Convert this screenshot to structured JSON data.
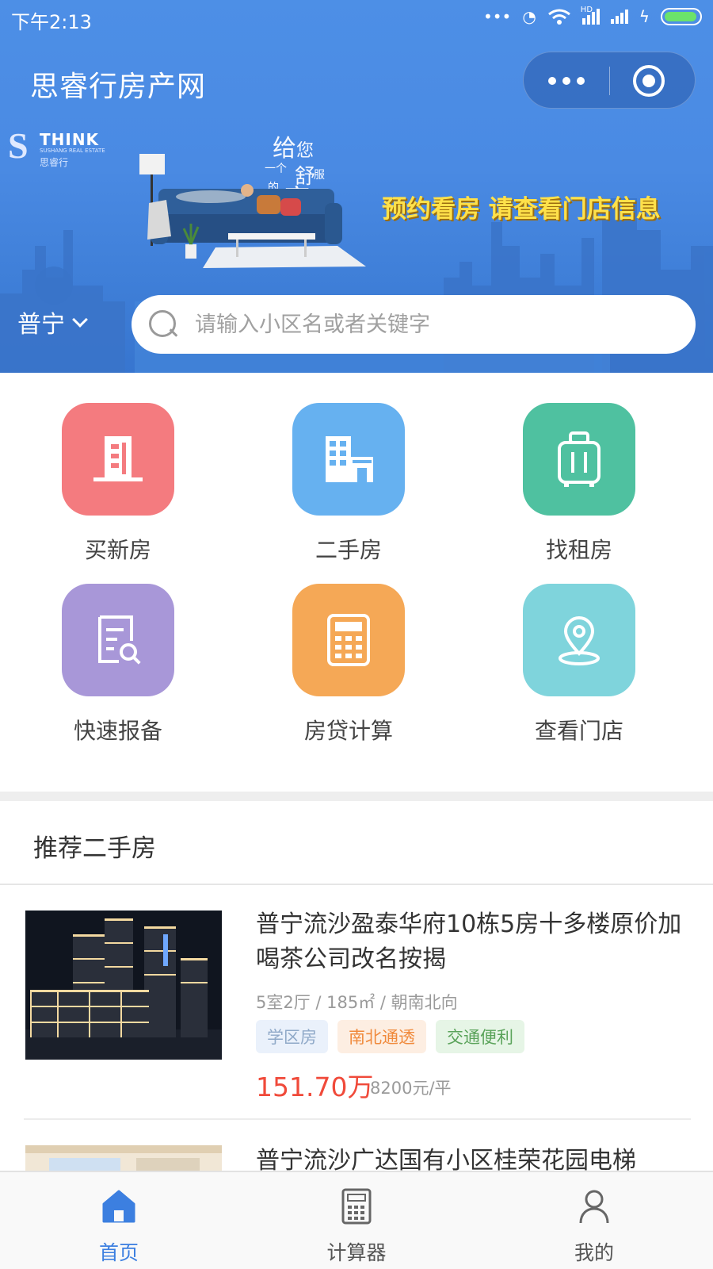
{
  "status_bar": {
    "time": "下午2:13",
    "network": "HD"
  },
  "header": {
    "app_title": "思睿行房产网",
    "capsule_more_icon": "more-dots-icon",
    "capsule_close_icon": "target-close-icon"
  },
  "banner": {
    "logo_en": "THINK",
    "logo_sub": "SUSHANG REAL ESTATE",
    "logo_cn": "思睿行",
    "slogan_small": [
      "给",
      "您",
      "一个",
      "舒",
      "服",
      "的",
      "家"
    ],
    "slogan_big": "预约看房 请查看门店信息"
  },
  "search": {
    "city": "普宁",
    "placeholder": "请输入小区名或者关键字"
  },
  "menu": [
    {
      "label": "买新房",
      "icon": "building-icon",
      "color": "#f47b7f"
    },
    {
      "label": "二手房",
      "icon": "buildings-icon",
      "color": "#66b1f0"
    },
    {
      "label": "找租房",
      "icon": "luggage-icon",
      "color": "#4fc1a0"
    },
    {
      "label": "快速报备",
      "icon": "report-search-icon",
      "color": "#a897d8"
    },
    {
      "label": "房贷计算",
      "icon": "calculator-icon",
      "color": "#f5a856"
    },
    {
      "label": "查看门店",
      "icon": "location-pin-icon",
      "color": "#7fd4dc"
    }
  ],
  "recommend": {
    "title": "推荐二手房",
    "listings": [
      {
        "title": "普宁流沙盈泰华府10栋5房十多楼原价加喝茶公司改名按揭",
        "meta": "5室2厅 / 185㎡ / 朝南北向",
        "tags": [
          "学区房",
          "南北通透",
          "交通便利"
        ],
        "price": "151.70万",
        "unit_price": "8200元/平"
      },
      {
        "title": "普宁流沙广达国有小区桂荣花园电梯"
      }
    ]
  },
  "tabbar": {
    "tabs": [
      {
        "label": "首页",
        "icon": "home-icon",
        "active": true
      },
      {
        "label": "计算器",
        "icon": "calculator-icon",
        "active": false
      },
      {
        "label": "我的",
        "icon": "user-icon",
        "active": false
      }
    ],
    "active_color": "#3c7fe0"
  }
}
